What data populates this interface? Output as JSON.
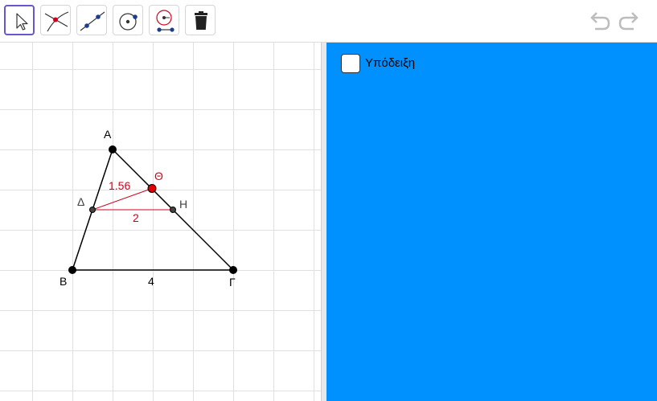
{
  "toolbar": {
    "tools": [
      {
        "name": "move-tool",
        "icon": "arrow-cursor-icon",
        "active": true
      },
      {
        "name": "intersect-tool",
        "icon": "intersect-icon",
        "active": false
      },
      {
        "name": "line-tool",
        "icon": "line-icon",
        "active": false
      },
      {
        "name": "circle-tool",
        "icon": "circle-center-icon",
        "active": false
      },
      {
        "name": "slider-tool",
        "icon": "slider-circle-icon",
        "active": false
      },
      {
        "name": "delete-tool",
        "icon": "trash-icon",
        "active": false
      }
    ],
    "undo_icon": "undo-icon",
    "redo_icon": "redo-icon"
  },
  "geometry": {
    "points": {
      "A": "Α",
      "B": "Β",
      "G": "Γ",
      "D": "Δ",
      "H": "Η",
      "TH": "Θ"
    },
    "labels": {
      "bg_length": "4",
      "dh_length": "2",
      "dth_length": "1.56"
    }
  },
  "panel": {
    "checkbox_label": "Υπόδειξη",
    "background": "#0091ff"
  },
  "colors": {
    "accent": "#6557d2",
    "red": "#d0021b",
    "grid": "#e0e0e0"
  }
}
